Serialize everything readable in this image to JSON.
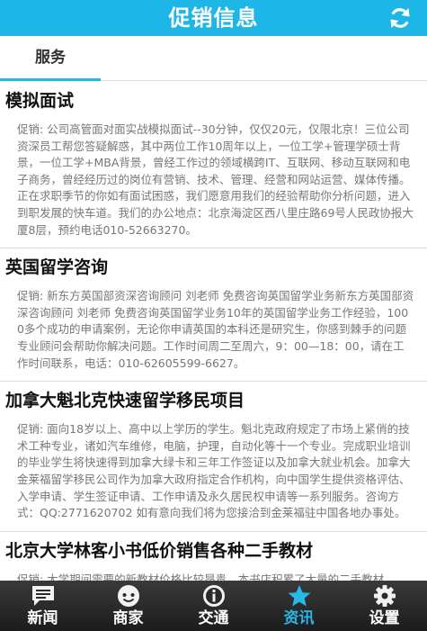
{
  "header": {
    "title": "促销信息",
    "refresh_icon": "refresh-icon"
  },
  "tabs": [
    {
      "label": "服务",
      "active": true
    }
  ],
  "items": [
    {
      "title": "模拟面试",
      "desc": "促销: 公司高管面对面实战模拟面试--30分钟，仅仅20元，仅限北京！三位公司资深员工帮您答疑解惑，其中两位工作10周年以上，一位工学+管理学硕士背景，一位工学+MBA背景，曾经工作过的领域横跨IT、互联网、移动互联网和电子商务，曾经经历过的岗位有营销、技术、管理、经营和网站运营、媒体传播。正在求职季节的你如有面试困惑，我们愿意用我们的经验帮助你分析问题，进入到职发展的快车道。我们的办公地点：北京海淀区西八里庄路69号人民政协报大厦8层，预约电话010-52663270。"
    },
    {
      "title": "英国留学咨询",
      "desc": "促销: 新东方英国部资深咨询顾问 刘老师 免费咨询英国留学业务新东方英国部资深咨询顾问 刘老师 免费咨询英国留学业务10年的英国留学业务工作经验，1000多个成功的申请案例，无论你申请英国的本科还是研究生，你感到棘手的问题专业顾问会帮助你解决问题。工作时间周二至周六，9：00—18：00，请在工作时间联系，电话：010-62605599-6627。"
    },
    {
      "title": "加拿大魁北克快速留学移民项目",
      "desc": "促销: 面向18岁以上、高中以上学历的学生。魁北克政府规定了市场上紧俏的技术工种专业，诸如汽车维修，电脑，护理，自动化等十一个专业。完成职业培训的毕业学生将快速得到加拿大绿卡和三年工作签证以及加拿大就业机会。加拿大金莱福留学移民公司作为加拿大政府指定合作机构，向中国学生提供资格评估、入学申请、学生签证申请、工作申请及永久居民权申请等一系列服务。咨询方式：QQ:2771620702 如有意向我们将为您接洽到金莱福驻中国各地办事处。"
    },
    {
      "title": "北京大学林客小书低价销售各种二手教材",
      "desc": "促销: 大学期间需要的新教材价格比较昂贵，本书店积累了大量的二手教材"
    }
  ],
  "bottom_nav": [
    {
      "label": "新闻",
      "icon": "news-icon",
      "active": false
    },
    {
      "label": "商家",
      "icon": "merchant-icon",
      "active": false
    },
    {
      "label": "交通",
      "icon": "info-icon",
      "active": false
    },
    {
      "label": "资讯",
      "icon": "star-icon",
      "active": true
    },
    {
      "label": "设置",
      "icon": "gear-icon",
      "active": false
    }
  ],
  "colors": {
    "accent": "#1eb6e6",
    "nav_active": "#27b7e8",
    "nav_bg": "#2a2a2a"
  }
}
